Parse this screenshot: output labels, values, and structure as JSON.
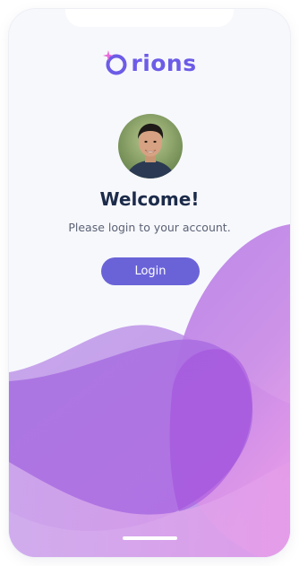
{
  "brand": {
    "name": "rions",
    "accent_color": "#6c5ce7",
    "sparkle_color": "#e86bd8"
  },
  "profile": {
    "avatar_icon": "user-avatar-photo"
  },
  "welcome": {
    "title": "Welcome!",
    "subtitle": "Please login to your account."
  },
  "actions": {
    "login_label": "Login",
    "login_color": "#6a63d8"
  },
  "colors": {
    "background": "#f7f8fc",
    "title": "#1c2b4a",
    "wave_purple": "#a96ee0",
    "wave_pink": "#e39ae8"
  }
}
